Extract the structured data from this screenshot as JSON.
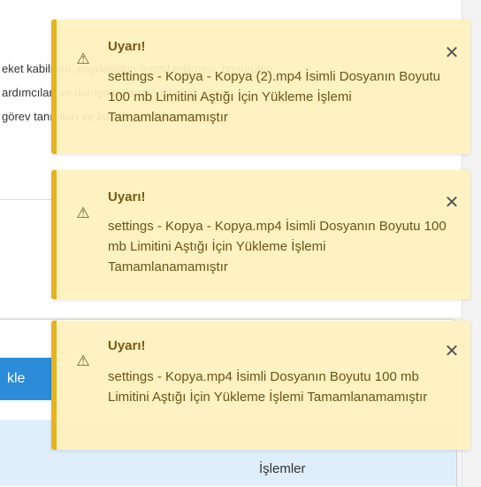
{
  "background": {
    "lines": [
      "eket kabiliyeti, paydaşların temsil edilmesi, öngörülen",
      "ardımcıları ve danışmanlarının işbirliği, görev",
      "görev tanımları ve kuralları belirlenmiştir"
    ],
    "button_label": "kle",
    "table_column": "İşlemler"
  },
  "toasts": [
    {
      "title": "Uyarı!",
      "message": "settings - Kopya - Kopya (2).mp4 İsimli Dosyanın Boyutu 100 mb Limitini Aştığı İçin Yükleme İşlemi Tamamlanamamıştır",
      "icon": "warning-icon",
      "close": "✕"
    },
    {
      "title": "Uyarı!",
      "message": "settings - Kopya - Kopya.mp4 İsimli Dosyanın Boyutu 100 mb Limitini Aştığı İçin Yükleme İşlemi Tamamlanamamıştır",
      "icon": "warning-icon",
      "close": "✕"
    },
    {
      "title": "Uyarı!",
      "message": "settings - Kopya.mp4 İsimli Dosyanın Boyutu 100 mb Limitini Aştığı İçin Yükleme İşlemi Tamamlanamamıştır",
      "icon": "warning-icon",
      "close": "✕"
    }
  ],
  "colors": {
    "toast_bg": "#fff1bd",
    "toast_border": "#e6b320",
    "button_bg": "#2d8cd9"
  }
}
